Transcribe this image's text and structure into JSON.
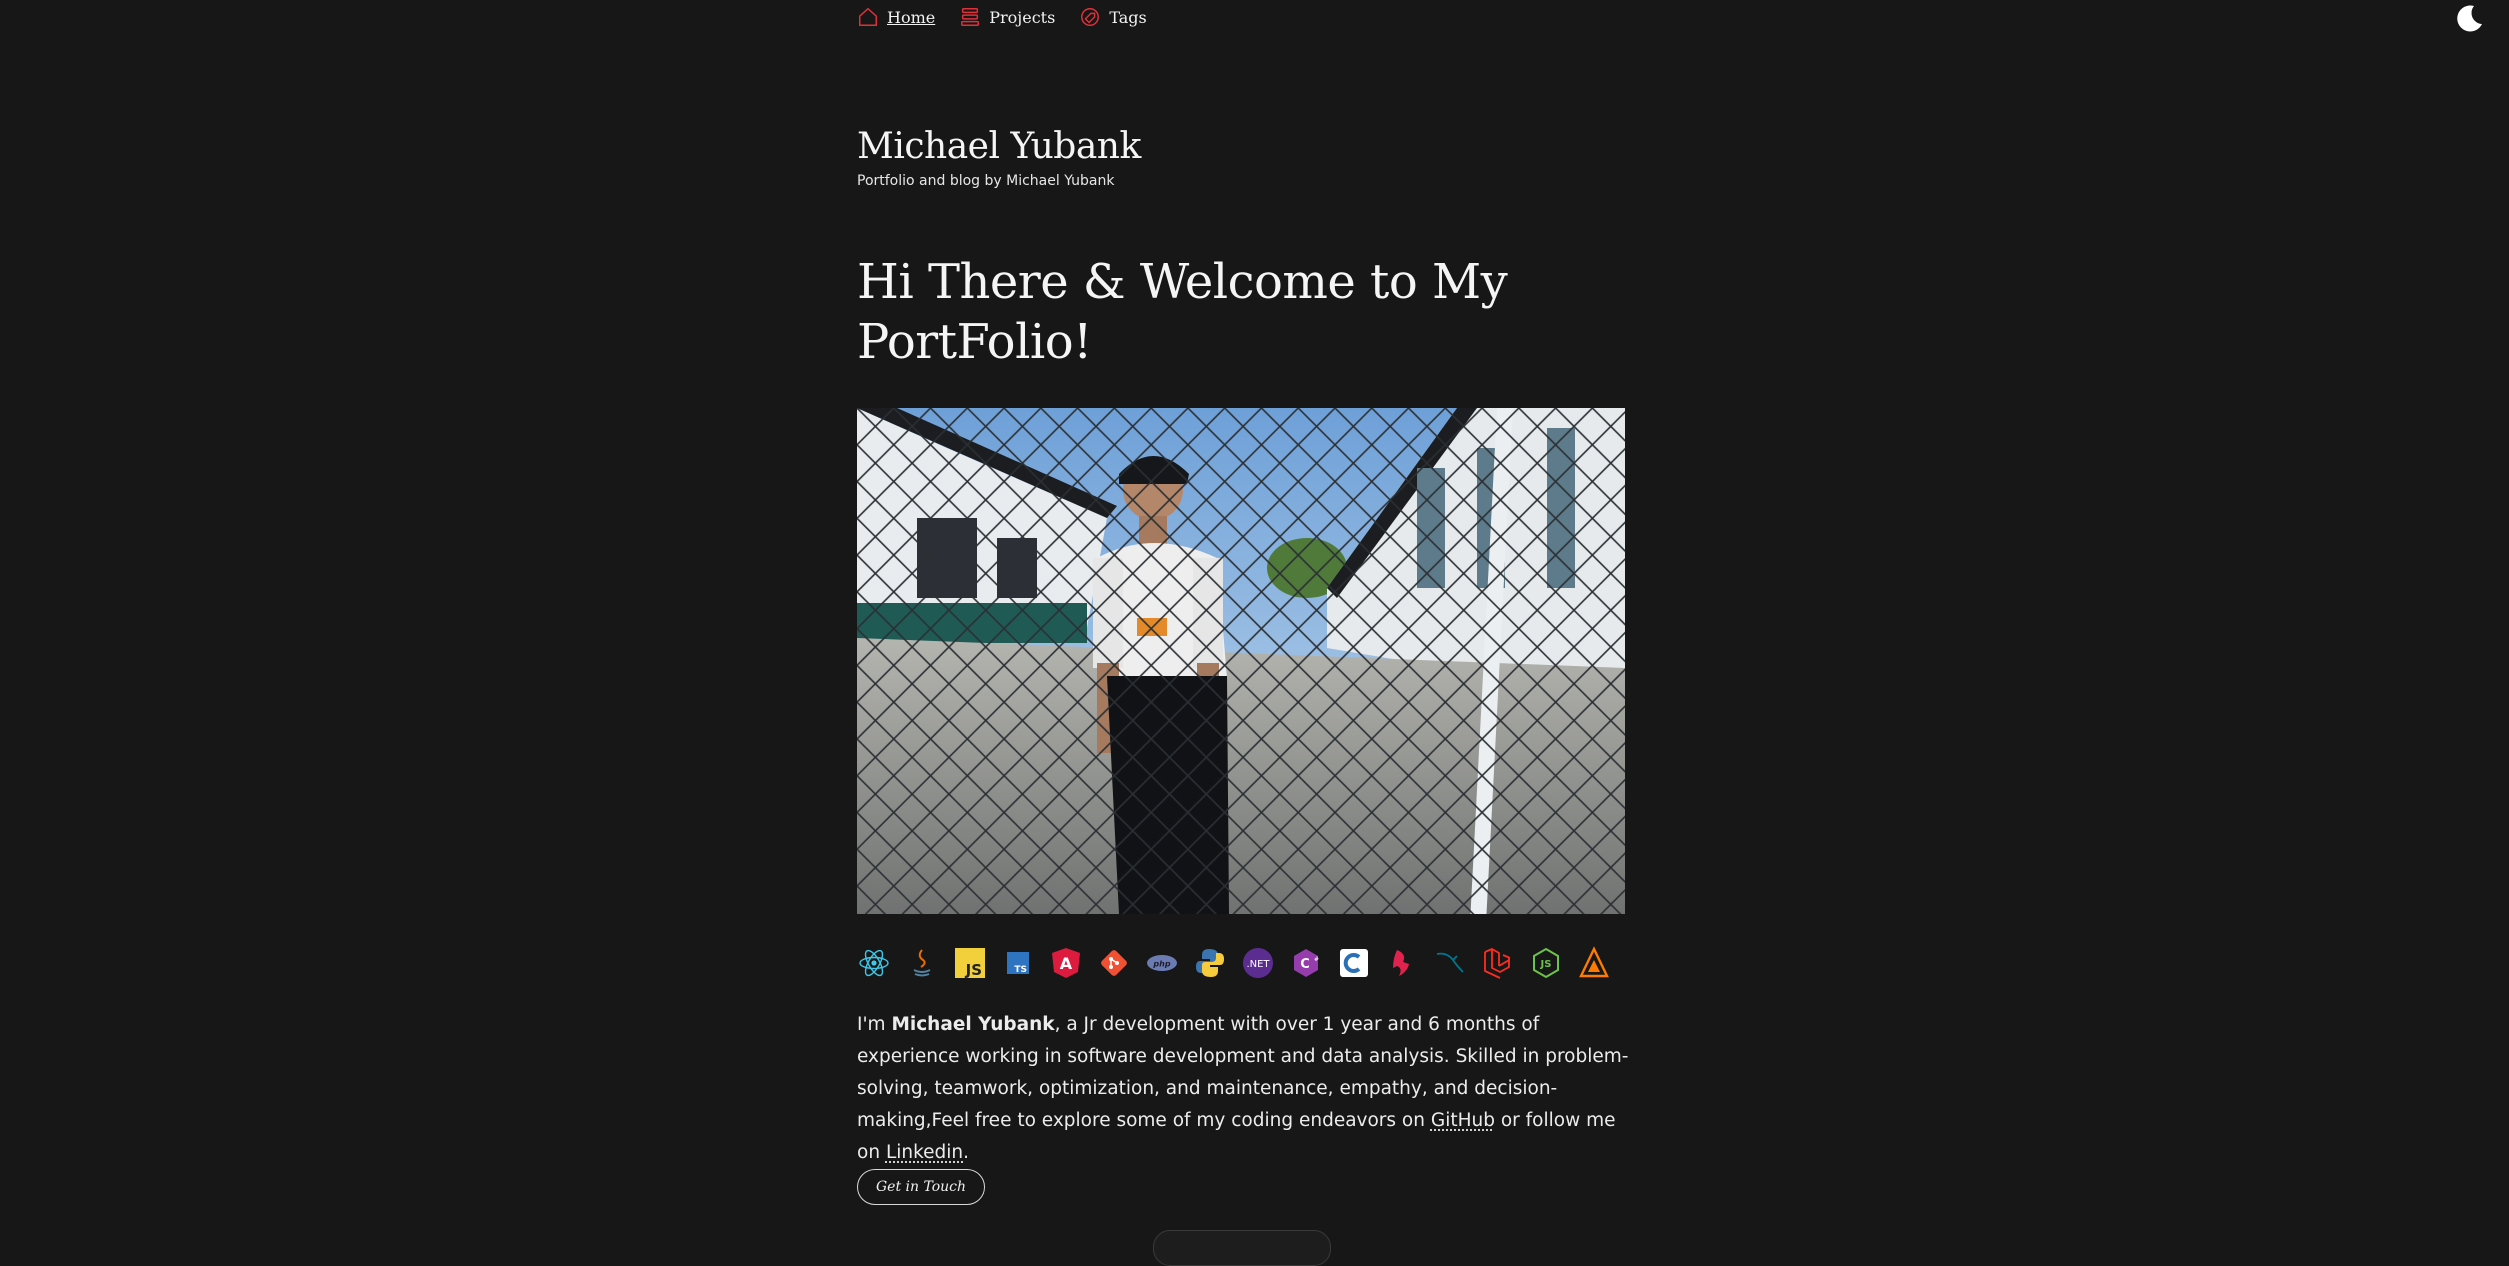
{
  "nav": {
    "items": [
      {
        "label": "Home",
        "icon": "home-icon",
        "active": true
      },
      {
        "label": "Projects",
        "icon": "projects-icon",
        "active": false
      },
      {
        "label": "Tags",
        "icon": "tags-icon",
        "active": false
      }
    ],
    "theme_toggle_icon": "moon-icon"
  },
  "site": {
    "title": "Michael Yubank",
    "subtitle": "Portfolio and blog by Michael Yubank"
  },
  "hero": {
    "heading": "Hi There & Welcome to My PortFolio!"
  },
  "tech_icons": [
    "react-icon",
    "java-icon",
    "javascript-icon",
    "typescript-icon",
    "angular-icon",
    "git-icon",
    "php-icon",
    "python-icon",
    "dotnet-icon",
    "csharp-icon",
    "c-icon",
    "nestjs-icon",
    "mysql-icon",
    "laravel-icon",
    "nodejs-icon",
    "aws-amplify-icon"
  ],
  "about": {
    "intro": "I'm ",
    "name": "Michael Yubank",
    "body": ", a Jr development with over 1 year and 6 months of experience working in software development and data analysis. Skilled in problem-solving, teamwork, optimization, and maintenance, empathy, and decision-making,Feel free to explore some of my coding endeavors on ",
    "github_link": "GitHub",
    "middle": " or follow me on ",
    "linkedin_link": "Linkedin",
    "end": "."
  },
  "cta": {
    "label": "Get in Touch"
  },
  "colors": {
    "background": "#171717",
    "accent": "#e0303a",
    "text": "#ececec"
  }
}
